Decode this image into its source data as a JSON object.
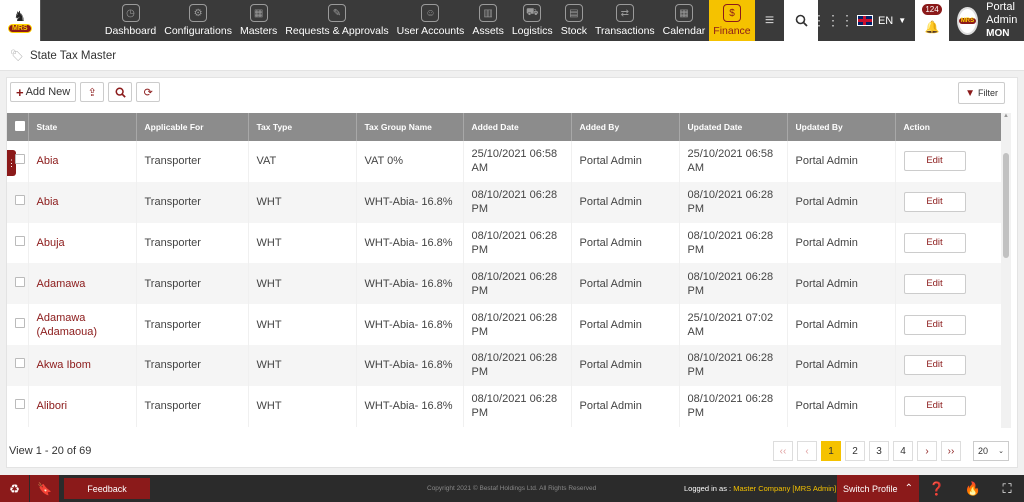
{
  "nav": {
    "items": [
      {
        "label": "Dashboard",
        "icon": "dashboard-icon",
        "glyph": "◷"
      },
      {
        "label": "Configurations",
        "icon": "gears-icon",
        "glyph": "⚙"
      },
      {
        "label": "Masters",
        "icon": "masters-icon",
        "glyph": "▦"
      },
      {
        "label": "Requests & Approvals",
        "icon": "approvals-icon",
        "glyph": "✎"
      },
      {
        "label": "User Accounts",
        "icon": "users-icon",
        "glyph": "☺"
      },
      {
        "label": "Assets",
        "icon": "assets-icon",
        "glyph": "▥"
      },
      {
        "label": "Logistics",
        "icon": "logistics-icon",
        "glyph": "⛟"
      },
      {
        "label": "Stock",
        "icon": "stock-icon",
        "glyph": "▤"
      },
      {
        "label": "Transactions",
        "icon": "transactions-icon",
        "glyph": "⇄"
      },
      {
        "label": "Calendar",
        "icon": "calendar-icon",
        "glyph": "▦"
      },
      {
        "label": "Finance",
        "icon": "finance-icon",
        "glyph": "$",
        "active": true
      }
    ],
    "language": "EN",
    "notification_count": "124",
    "user_name": "Portal Admin",
    "user_code": "MON",
    "logo_text": "MRS"
  },
  "breadcrumb": {
    "title": "State Tax Master"
  },
  "toolbar": {
    "add_new": "Add New",
    "filter": "Filter"
  },
  "table": {
    "columns": [
      "State",
      "Applicable For",
      "Tax Type",
      "Tax Group Name",
      "Added Date",
      "Added By",
      "Updated Date",
      "Updated By",
      "Action"
    ],
    "rows": [
      {
        "state": "Abia",
        "applicable_for": "Transporter",
        "tax_type": "VAT",
        "tax_group": "VAT 0%",
        "added_date": "25/10/2021 06:58 AM",
        "added_by": "Portal Admin",
        "updated_date": "25/10/2021 06:58 AM",
        "updated_by": "Portal Admin",
        "action": "Edit"
      },
      {
        "state": "Abia",
        "applicable_for": "Transporter",
        "tax_type": "WHT",
        "tax_group": "WHT-Abia- 16.8%",
        "added_date": "08/10/2021 06:28 PM",
        "added_by": "Portal Admin",
        "updated_date": "08/10/2021 06:28 PM",
        "updated_by": "Portal Admin",
        "action": "Edit"
      },
      {
        "state": "Abuja",
        "applicable_for": "Transporter",
        "tax_type": "WHT",
        "tax_group": "WHT-Abia- 16.8%",
        "added_date": "08/10/2021 06:28 PM",
        "added_by": "Portal Admin",
        "updated_date": "08/10/2021 06:28 PM",
        "updated_by": "Portal Admin",
        "action": "Edit"
      },
      {
        "state": "Adamawa",
        "applicable_for": "Transporter",
        "tax_type": "WHT",
        "tax_group": "WHT-Abia- 16.8%",
        "added_date": "08/10/2021 06:28 PM",
        "added_by": "Portal Admin",
        "updated_date": "08/10/2021 06:28 PM",
        "updated_by": "Portal Admin",
        "action": "Edit"
      },
      {
        "state": "Adamawa (Adamaoua)",
        "applicable_for": "Transporter",
        "tax_type": "WHT",
        "tax_group": "WHT-Abia- 16.8%",
        "added_date": "08/10/2021 06:28 PM",
        "added_by": "Portal Admin",
        "updated_date": "25/10/2021 07:02 AM",
        "updated_by": "Portal Admin",
        "action": "Edit"
      },
      {
        "state": "Akwa Ibom",
        "applicable_for": "Transporter",
        "tax_type": "WHT",
        "tax_group": "WHT-Abia- 16.8%",
        "added_date": "08/10/2021 06:28 PM",
        "added_by": "Portal Admin",
        "updated_date": "08/10/2021 06:28 PM",
        "updated_by": "Portal Admin",
        "action": "Edit"
      },
      {
        "state": "Alibori",
        "applicable_for": "Transporter",
        "tax_type": "WHT",
        "tax_group": "WHT-Abia- 16.8%",
        "added_date": "08/10/2021 06:28 PM",
        "added_by": "Portal Admin",
        "updated_date": "08/10/2021 06:28 PM",
        "updated_by": "Portal Admin",
        "action": "Edit"
      }
    ]
  },
  "pagination": {
    "view_info": "View 1 - 20 of 69",
    "first": "‹‹",
    "prev": "‹",
    "pages": [
      "1",
      "2",
      "3",
      "4"
    ],
    "current": "1",
    "next": "›",
    "last": "››",
    "page_size": "20"
  },
  "footer": {
    "feedback": "Feedback",
    "copyright": "Copyright 2021 © Bestaf Holdings Ltd. All Rights Reserved",
    "logged_in_label": "Logged in as :",
    "logged_in_company": "Master Company [MRS Admin]",
    "switch_profile": "Switch Profile"
  },
  "colors": {
    "brand": "#8b1a1a",
    "accent": "#f5c200",
    "nav_bg": "#3a3a3a",
    "header_bg": "#8c8c8c"
  }
}
